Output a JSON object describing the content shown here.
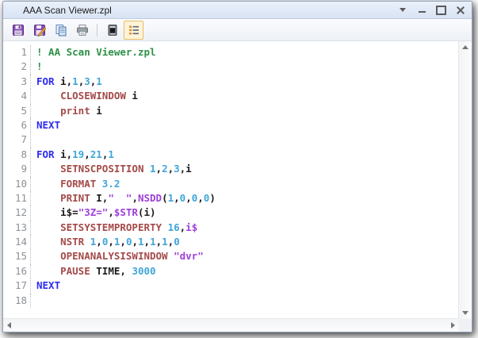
{
  "window": {
    "title": "AAA Scan Viewer.zpl",
    "controls": [
      "menu-dropdown",
      "minimize",
      "maximize",
      "close"
    ]
  },
  "toolbar": {
    "items": [
      {
        "icon": "save-icon"
      },
      {
        "icon": "save-as-icon"
      },
      {
        "icon": "copy-icon"
      },
      {
        "icon": "print-icon"
      },
      {
        "icon": "separator"
      },
      {
        "icon": "preview-icon"
      },
      {
        "icon": "line-numbers-icon",
        "active": true
      }
    ]
  },
  "editor": {
    "syntax_colors": {
      "comment": "#2e9147",
      "flow_keyword": "#2b2bef",
      "command": "#a34a49",
      "number": "#3ea5d9",
      "string_function": "#9e3fd9",
      "plain": "#1a1a1a",
      "line_number": "#8d9196"
    },
    "lines": [
      {
        "num": "1",
        "tokens": [
          [
            "com",
            "! AA Scan Viewer.zpl"
          ]
        ]
      },
      {
        "num": "2",
        "tokens": [
          [
            "com",
            "!"
          ]
        ]
      },
      {
        "num": "3",
        "tokens": [
          [
            "kw",
            "FOR"
          ],
          [
            "pl",
            " i,"
          ],
          [
            "num",
            "1"
          ],
          [
            "pl",
            ","
          ],
          [
            "num",
            "3"
          ],
          [
            "pl",
            ","
          ],
          [
            "num",
            "1"
          ]
        ]
      },
      {
        "num": "4",
        "tokens": [
          [
            "pl",
            "    "
          ],
          [
            "cmd",
            "CLOSEWINDOW"
          ],
          [
            "pl",
            " i"
          ]
        ]
      },
      {
        "num": "5",
        "tokens": [
          [
            "pl",
            "    "
          ],
          [
            "cmd",
            "print"
          ],
          [
            "pl",
            " i"
          ]
        ]
      },
      {
        "num": "6",
        "tokens": [
          [
            "kw",
            "NEXT"
          ]
        ]
      },
      {
        "num": "7",
        "tokens": []
      },
      {
        "num": "8",
        "tokens": [
          [
            "kw",
            "FOR"
          ],
          [
            "pl",
            " i,"
          ],
          [
            "num",
            "19"
          ],
          [
            "pl",
            ","
          ],
          [
            "num",
            "21"
          ],
          [
            "pl",
            ","
          ],
          [
            "num",
            "1"
          ]
        ]
      },
      {
        "num": "9",
        "tokens": [
          [
            "pl",
            "    "
          ],
          [
            "cmd",
            "SETNSCPOSITION"
          ],
          [
            "pl",
            " "
          ],
          [
            "num",
            "1"
          ],
          [
            "pl",
            ","
          ],
          [
            "num",
            "2"
          ],
          [
            "pl",
            ","
          ],
          [
            "num",
            "3"
          ],
          [
            "pl",
            ",i"
          ]
        ]
      },
      {
        "num": "10",
        "tokens": [
          [
            "pl",
            "    "
          ],
          [
            "cmd",
            "FORMAT"
          ],
          [
            "pl",
            " "
          ],
          [
            "num",
            "3.2"
          ]
        ]
      },
      {
        "num": "11",
        "tokens": [
          [
            "pl",
            "    "
          ],
          [
            "cmd",
            "PRINT"
          ],
          [
            "pl",
            " I,"
          ],
          [
            "str",
            "\"  \""
          ],
          [
            "pl",
            ","
          ],
          [
            "fn",
            "NSDD"
          ],
          [
            "pl",
            "("
          ],
          [
            "num",
            "1"
          ],
          [
            "pl",
            ","
          ],
          [
            "num",
            "0"
          ],
          [
            "pl",
            ","
          ],
          [
            "num",
            "0"
          ],
          [
            "pl",
            ","
          ],
          [
            "num",
            "0"
          ],
          [
            "pl",
            ")"
          ]
        ]
      },
      {
        "num": "12",
        "tokens": [
          [
            "pl",
            "    "
          ],
          [
            "pl",
            "i$="
          ],
          [
            "str",
            "\"3Z=\""
          ],
          [
            "pl",
            ","
          ],
          [
            "fn",
            "$STR"
          ],
          [
            "pl",
            "(i)"
          ]
        ]
      },
      {
        "num": "13",
        "tokens": [
          [
            "pl",
            "    "
          ],
          [
            "cmd",
            "SETSYSTEMPROPERTY"
          ],
          [
            "pl",
            " "
          ],
          [
            "num",
            "16"
          ],
          [
            "pl",
            ","
          ],
          [
            "fn",
            "i$"
          ]
        ]
      },
      {
        "num": "14",
        "tokens": [
          [
            "pl",
            "    "
          ],
          [
            "cmd",
            "NSTR"
          ],
          [
            "pl",
            " "
          ],
          [
            "num",
            "1"
          ],
          [
            "pl",
            ","
          ],
          [
            "num",
            "0"
          ],
          [
            "pl",
            ","
          ],
          [
            "num",
            "1"
          ],
          [
            "pl",
            ","
          ],
          [
            "num",
            "0"
          ],
          [
            "pl",
            ","
          ],
          [
            "num",
            "1"
          ],
          [
            "pl",
            ","
          ],
          [
            "num",
            "1"
          ],
          [
            "pl",
            ","
          ],
          [
            "num",
            "1"
          ],
          [
            "pl",
            ","
          ],
          [
            "num",
            "0"
          ]
        ]
      },
      {
        "num": "15",
        "tokens": [
          [
            "pl",
            "    "
          ],
          [
            "cmd",
            "OPENANALYSISWINDOW"
          ],
          [
            "pl",
            " "
          ],
          [
            "str",
            "\"dvr\""
          ]
        ]
      },
      {
        "num": "16",
        "tokens": [
          [
            "pl",
            "    "
          ],
          [
            "cmd",
            "PAUSE"
          ],
          [
            "pl",
            " TIME, "
          ],
          [
            "num",
            "3000"
          ]
        ]
      },
      {
        "num": "17",
        "tokens": [
          [
            "kw",
            "NEXT"
          ]
        ]
      },
      {
        "num": "18",
        "tokens": []
      }
    ]
  }
}
